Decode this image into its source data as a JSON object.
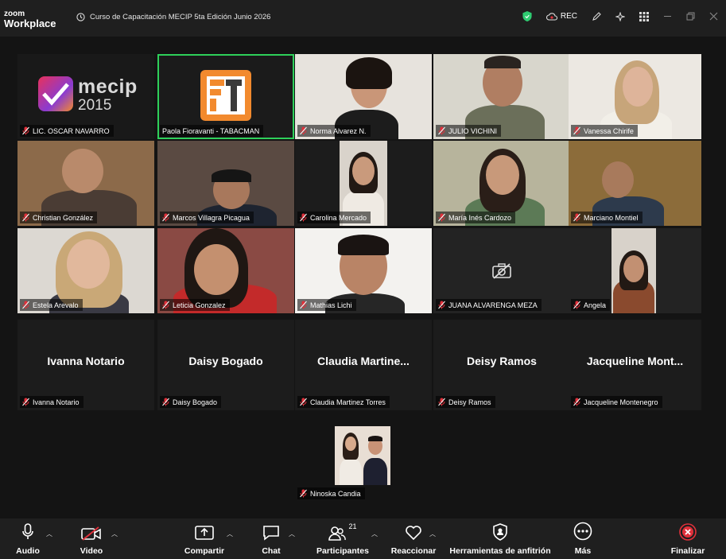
{
  "titlebar": {
    "logo_top": "zoom",
    "logo_bottom": "Workplace",
    "meeting_title": "Curso de Capacitación MECIP 5ta Edición Junio 2026",
    "rec_label": "REC"
  },
  "tiles": [
    {
      "name": "LIC. OSCAR NAVARRO",
      "logo_text": "mecip",
      "logo_year": "2015"
    },
    {
      "name": "Paola Fioravanti - TABACMAN"
    },
    {
      "name": "Norma Alvarez N."
    },
    {
      "name": "JULIO VICHINI"
    },
    {
      "name": "Vanessa Chirife"
    },
    {
      "name": "Christian González"
    },
    {
      "name": "Marcos Villagra Picagua"
    },
    {
      "name": "Carolina Mercado"
    },
    {
      "name": "María Inés Cardozo"
    },
    {
      "name": "Marciano Montiel"
    },
    {
      "name": "Estela Arevalo"
    },
    {
      "name": "Leticia Gonzalez"
    },
    {
      "name": "Mathias Lichi"
    },
    {
      "name": "JUANA ALVARENGA MEZA"
    },
    {
      "name": "Angela"
    },
    {
      "name": "Ivanna Notario",
      "display": "Ivanna Notario"
    },
    {
      "name": "Daisy Bogado",
      "display": "Daisy Bogado"
    },
    {
      "name": "Claudia Martinez Torres",
      "display": "Claudia  Martine..."
    },
    {
      "name": "Deisy Ramos",
      "display": "Deisy Ramos"
    },
    {
      "name": "Jacqueline Montenegro",
      "display": "Jacqueline  Mont..."
    },
    {
      "name": "Ninoska Candia"
    }
  ],
  "toolbar": {
    "audio": "Audio",
    "video": "Video",
    "share": "Compartir",
    "chat": "Chat",
    "participants": "Participantes",
    "participants_count": "21",
    "react": "Reaccionar",
    "host_tools": "Herramientas de anfitrión",
    "more": "Más",
    "end": "Finalizar"
  },
  "colors": {
    "active_speaker": "#2ed05a",
    "muted_mic": "#e0303a",
    "shield": "#2ecc71",
    "end_button": "#e0303a"
  }
}
